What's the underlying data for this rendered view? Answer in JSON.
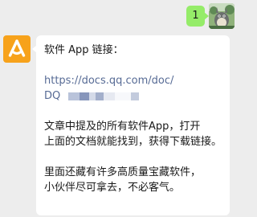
{
  "outgoing_message": {
    "text": "1"
  },
  "incoming_message": {
    "title": "软件 App 链接：",
    "link_line1": "https://docs.qq.com/doc/",
    "link_line2": "DQ",
    "para1_line1": "文章中提及的所有软件App，打开",
    "para1_line2": "上面的文档就能找到，获得下载链接。",
    "para2_line1": "里面还藏有许多高质量宝藏软件，",
    "para2_line2": "小伙伴尽可拿去，不必客气。"
  },
  "colors": {
    "chat_background": "#ededed",
    "outgoing_bubble": "#95ec69",
    "incoming_bubble": "#ffffff",
    "sender_avatar": "#f7a21b",
    "link": "#576b95"
  }
}
